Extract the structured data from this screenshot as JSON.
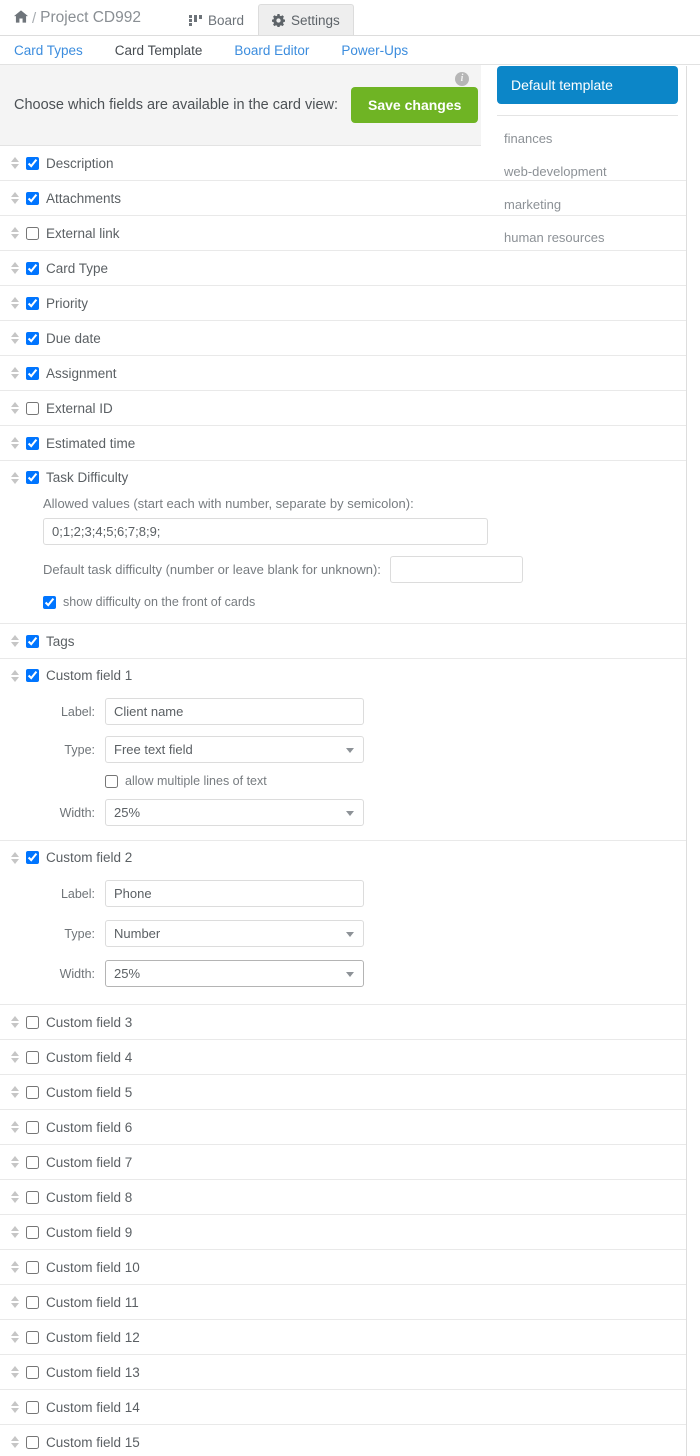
{
  "topbar": {
    "home_icon": "home-icon",
    "separator": "/",
    "project": "Project CD992",
    "tabs": [
      {
        "label": "Board",
        "icon": "board-grid-icon",
        "active": false
      },
      {
        "label": "Settings",
        "icon": "gear-icon",
        "active": true
      }
    ]
  },
  "subnav": {
    "items": [
      {
        "label": "Card Types",
        "current": false
      },
      {
        "label": "Card Template",
        "current": true
      },
      {
        "label": "Board Editor",
        "current": false
      },
      {
        "label": "Power-Ups",
        "current": false
      }
    ]
  },
  "header": {
    "prompt": "Choose which fields are available in the card view:",
    "save_label": "Save changes",
    "info_icon": "info-icon",
    "save_color": "#6fb424"
  },
  "templates": {
    "active_label": "Default template",
    "active_color": "#0c86c8",
    "items": [
      {
        "label": "finances"
      },
      {
        "label": "web-development"
      },
      {
        "label": "marketing"
      },
      {
        "label": "human resources"
      }
    ]
  },
  "fields": [
    {
      "label": "Description",
      "checked": true
    },
    {
      "label": "Attachments",
      "checked": true
    },
    {
      "label": "External link",
      "checked": false
    },
    {
      "label": "Card Type",
      "checked": true
    },
    {
      "label": "Priority",
      "checked": true
    },
    {
      "label": "Due date",
      "checked": true
    },
    {
      "label": "Assignment",
      "checked": true
    },
    {
      "label": "External ID",
      "checked": false
    },
    {
      "label": "Estimated time",
      "checked": true
    }
  ],
  "task_difficulty": {
    "label": "Task Difficulty",
    "checked": true,
    "allowed_values_label": "Allowed values (start each with number, separate by semicolon):",
    "allowed_values": "0;1;2;3;4;5;6;7;8;9;",
    "default_label": "Default task difficulty (number or leave blank for unknown):",
    "default_value": "",
    "show_front_label": "show difficulty on the front of cards",
    "show_front_checked": true
  },
  "tags": {
    "label": "Tags",
    "checked": true
  },
  "custom_field_1": {
    "label": "Custom field 1",
    "checked": true,
    "label_caption": "Label:",
    "label_value": "Client name",
    "type_caption": "Type:",
    "type_value": "Free text field",
    "multiline_caption": "allow multiple lines of text",
    "multiline_checked": false,
    "width_caption": "Width:",
    "width_value": "25%"
  },
  "custom_field_2": {
    "label": "Custom field 2",
    "checked": true,
    "label_caption": "Label:",
    "label_value": "Phone",
    "type_caption": "Type:",
    "type_value": "Number",
    "width_caption": "Width:",
    "width_value": "25%"
  },
  "remaining_fields": [
    {
      "label": "Custom field 3",
      "checked": false
    },
    {
      "label": "Custom field 4",
      "checked": false
    },
    {
      "label": "Custom field 5",
      "checked": false
    },
    {
      "label": "Custom field 6",
      "checked": false
    },
    {
      "label": "Custom field 7",
      "checked": false
    },
    {
      "label": "Custom field 8",
      "checked": false
    },
    {
      "label": "Custom field 9",
      "checked": false
    },
    {
      "label": "Custom field 10",
      "checked": false
    },
    {
      "label": "Custom field 11",
      "checked": false
    },
    {
      "label": "Custom field 12",
      "checked": false
    },
    {
      "label": "Custom field 13",
      "checked": false
    },
    {
      "label": "Custom field 14",
      "checked": false
    },
    {
      "label": "Custom field 15",
      "checked": false
    }
  ]
}
